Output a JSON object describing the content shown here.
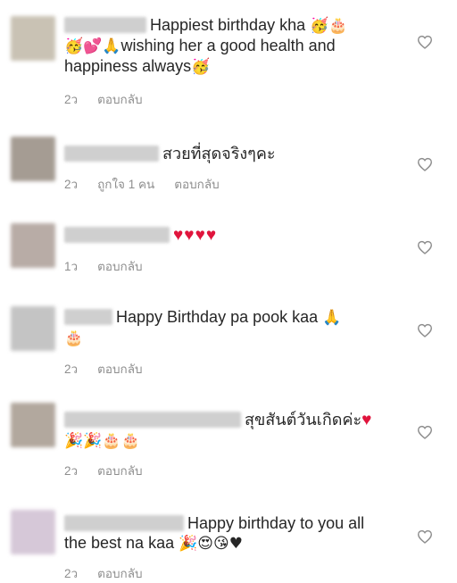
{
  "comments": [
    {
      "text": "Happiest birthday kha",
      "text_emoji": "🥳🎂",
      "line2_emoji": "🥳💕🙏",
      "line2_text": "wishing her a good health and",
      "line3_text": "happiness always",
      "line3_emoji": "🥳",
      "time": "2ว",
      "reply": "ตอบกลับ",
      "avatar_color": "#c9c2b4"
    },
    {
      "text": "สวยที่สุดจริงๆคะ",
      "time": "2ว",
      "likes": "ถูกใจ 1 คน",
      "reply": "ตอบกลับ",
      "avatar_color": "#a59c93"
    },
    {
      "hearts": "♥♥♥♥",
      "time": "1ว",
      "reply": "ตอบกลับ",
      "avatar_color": "#b8aca6"
    },
    {
      "text": "Happy Birthday pa pook kaa",
      "text_emoji": "🙏",
      "line2_emoji": "🎂",
      "time": "2ว",
      "reply": "ตอบกลับ",
      "avatar_color": "#c4c4c4"
    },
    {
      "text": "สุขสันต์วันเกิดค่ะ",
      "text_emoji": "♥",
      "line2_emoji": "🎉🎉🎂🎂",
      "time": "2ว",
      "reply": "ตอบกลับ",
      "avatar_color": "#b2a89e"
    },
    {
      "text": "Happy birthday to you all",
      "line2_text": "the best na kaa",
      "line2_emoji": "🎉😍😘♥",
      "time": "2ว",
      "reply": "ตอบกลับ",
      "avatar_color": "#d6c8d8"
    }
  ],
  "icons": {
    "like": "heart-outline-icon"
  },
  "colors": {
    "meta": "#8e8e8e",
    "text": "#262626",
    "heart_red": "#e0143c"
  }
}
